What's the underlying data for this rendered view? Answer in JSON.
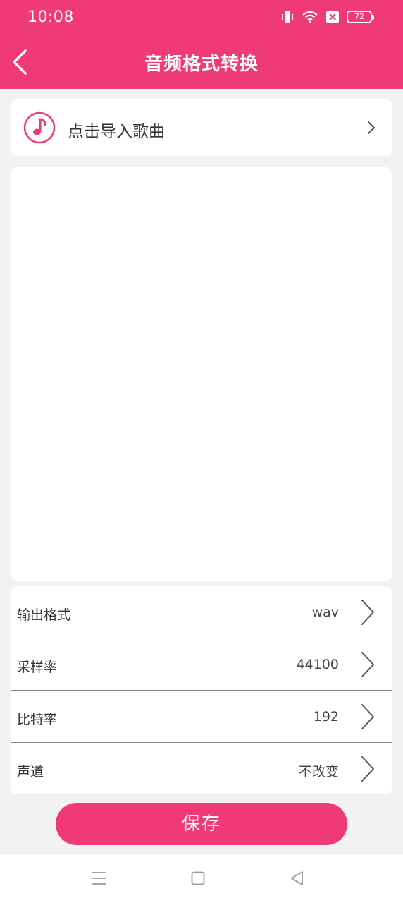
{
  "status_bar": {
    "time": "10:08",
    "battery": "72",
    "icons": [
      "vibrate-icon",
      "wifi-icon",
      "sim-error-icon",
      "battery-icon"
    ]
  },
  "header": {
    "title": "音频格式转换",
    "back_icon": "back-arrow-icon"
  },
  "import": {
    "label": "点击导入歌曲",
    "icon": "music-note-icon"
  },
  "settings": [
    {
      "label": "输出格式",
      "value": "wav"
    },
    {
      "label": "采样率",
      "value": "44100"
    },
    {
      "label": "比特率",
      "value": "192"
    },
    {
      "label": "声道",
      "value": "不改变"
    }
  ],
  "save_button": {
    "label": "保存"
  },
  "navigation": {
    "icons": [
      "menu-icon",
      "home-icon",
      "back-icon"
    ]
  },
  "colors": {
    "accent": "#f03a78",
    "background": "#f2f2f2",
    "card": "#ffffff"
  }
}
